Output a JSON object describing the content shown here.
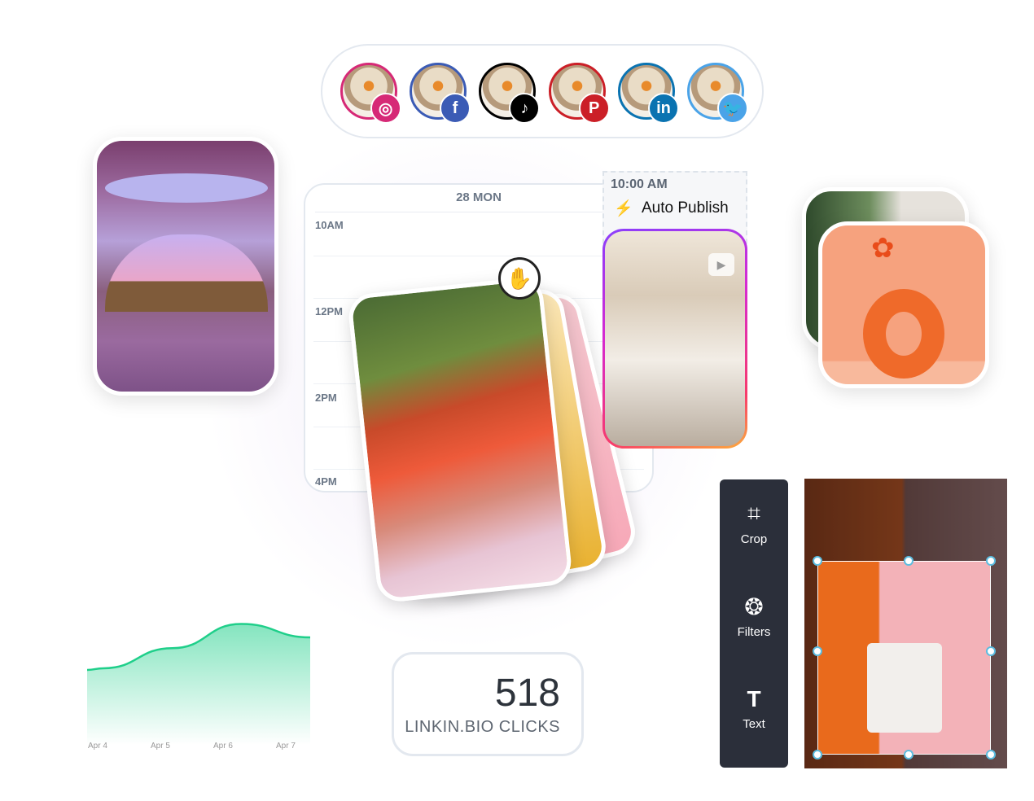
{
  "social_accounts": [
    {
      "network": "instagram",
      "icon": "instagram-icon",
      "color": "#d62976",
      "glyph": "◎"
    },
    {
      "network": "facebook",
      "icon": "facebook-icon",
      "color": "#3b5bb5",
      "glyph": "f"
    },
    {
      "network": "tiktok",
      "icon": "tiktok-icon",
      "color": "#000000",
      "glyph": "♪"
    },
    {
      "network": "pinterest",
      "icon": "pinterest-icon",
      "color": "#cb1f27",
      "glyph": "P"
    },
    {
      "network": "linkedin",
      "icon": "linkedin-icon",
      "color": "#0a73b1",
      "glyph": "in"
    },
    {
      "network": "twitter",
      "icon": "twitter-icon",
      "color": "#4aa3e8",
      "glyph": "🐦"
    }
  ],
  "calendar": {
    "day": "28 MON",
    "times": [
      "10AM",
      "12PM",
      "2PM",
      "4PM"
    ]
  },
  "scheduled_post": {
    "time": "10:00 AM",
    "label": "Auto Publish"
  },
  "stat": {
    "value": "518",
    "label": "LINKIN.BIO CLICKS"
  },
  "editor": {
    "tools": [
      {
        "label": "Crop",
        "icon": "crop-icon",
        "glyph": "⌗"
      },
      {
        "label": "Filters",
        "icon": "aperture-icon",
        "glyph": "❂"
      },
      {
        "label": "Text",
        "icon": "text-icon",
        "glyph": "T"
      }
    ]
  },
  "chart_data": {
    "type": "area",
    "categories": [
      "Apr 4",
      "Apr 5",
      "Apr 6",
      "Apr 7"
    ],
    "values": [
      57,
      72,
      90,
      80
    ],
    "color": "#1fcf8a",
    "grid": false,
    "ylim": [
      0,
      100
    ]
  }
}
